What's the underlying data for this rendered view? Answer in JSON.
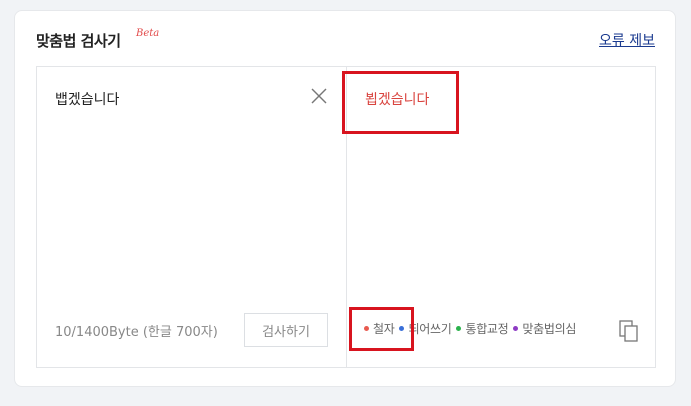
{
  "header": {
    "title": "맞춤법 검사기",
    "beta": "Beta",
    "report_link": "오류 제보"
  },
  "input": {
    "text": "뱁겠습니다",
    "byte_count": "10/1400Byte (한글 700자)",
    "check_button": "검사하기"
  },
  "result": {
    "text": "뵙겠습니다"
  },
  "legend": [
    {
      "label": "철자",
      "color": "#e85a4f"
    },
    {
      "label": "띄어쓰기",
      "color": "#3a6fd8"
    },
    {
      "label": "통합교정",
      "color": "#2bb24c"
    },
    {
      "label": "맞춤법의심",
      "color": "#8e3bc4"
    }
  ],
  "colors": {
    "highlight": "#d8141f",
    "result_text": "#d9443f",
    "link": "#1a3a8f"
  }
}
